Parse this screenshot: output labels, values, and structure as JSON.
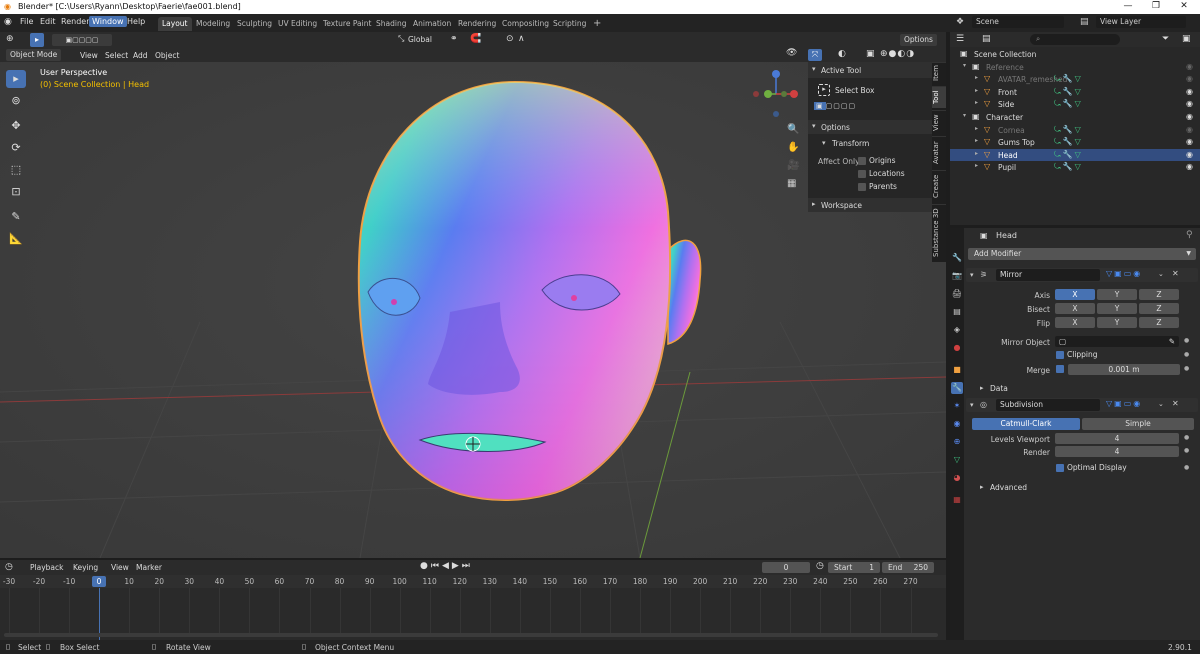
{
  "titlebar": {
    "title": "Blender* [C:\\Users\\Ryann\\Desktop\\Faerie\\fae001.blend]",
    "minimize": "—",
    "maximize": "❐",
    "close": "✕"
  },
  "menu": [
    "File",
    "Edit",
    "Render",
    "Window",
    "Help"
  ],
  "workspaces": [
    "Layout",
    "Modeling",
    "Sculpting",
    "UV Editing",
    "Texture Paint",
    "Shading",
    "Animation",
    "Rendering",
    "Compositing",
    "Scripting"
  ],
  "add_workspace": "+",
  "scene": {
    "label": "Scene",
    "view_layer": "View Layer"
  },
  "viewport_header": {
    "transform": "Global",
    "options": "Options"
  },
  "viewport_menu": {
    "mode": "Object Mode",
    "view": "View",
    "select": "Select",
    "add": "Add",
    "object": "Object"
  },
  "viewport_overlay": {
    "perspective": "User Perspective",
    "collection": "(0) Scene Collection | Head"
  },
  "npanel": {
    "active_tool_title": "Active Tool",
    "select_box": "Select Box",
    "options_title": "Options",
    "transform": "Transform",
    "affect_only": "Affect Only",
    "origins": "Origins",
    "locations": "Locations",
    "parents": "Parents",
    "workspace": "Workspace",
    "tabs": [
      "Item",
      "Tool",
      "View",
      "Avatar",
      "Create",
      "Substance 3D"
    ]
  },
  "outliner": {
    "search_placeholder": "",
    "rows": [
      {
        "label": "Scene Collection",
        "indent": 0,
        "dim": false,
        "sel": false
      },
      {
        "label": "Reference",
        "indent": 1,
        "dim": true,
        "sel": false
      },
      {
        "label": "AVATAR_remeshed",
        "indent": 2,
        "dim": true,
        "sel": false
      },
      {
        "label": "Front",
        "indent": 2,
        "dim": false,
        "sel": false
      },
      {
        "label": "Side",
        "indent": 2,
        "dim": false,
        "sel": false
      },
      {
        "label": "Character",
        "indent": 1,
        "dim": false,
        "sel": false
      },
      {
        "label": "Cornea",
        "indent": 2,
        "dim": true,
        "sel": false
      },
      {
        "label": "Gums Top",
        "indent": 2,
        "dim": false,
        "sel": false
      },
      {
        "label": "Head",
        "indent": 2,
        "dim": false,
        "sel": true
      },
      {
        "label": "Pupil",
        "indent": 2,
        "dim": false,
        "sel": false
      }
    ]
  },
  "properties": {
    "object_name": "Head",
    "add_modifier": "Add Modifier",
    "mirror": {
      "name": "Mirror",
      "axis_label": "Axis",
      "bisect_label": "Bisect",
      "flip_label": "Flip",
      "x": "X",
      "y": "Y",
      "z": "Z",
      "mirror_object_label": "Mirror Object",
      "clipping": "Clipping",
      "merge_label": "Merge",
      "merge_value": "0.001 m",
      "data": "Data"
    },
    "subdivision": {
      "name": "Subdivision",
      "catmull": "Catmull-Clark",
      "simple": "Simple",
      "levels_label": "Levels Viewport",
      "levels_value": "4",
      "render_label": "Render",
      "render_value": "4",
      "optimal": "Optimal Display",
      "advanced": "Advanced"
    }
  },
  "timeline": {
    "playback": "Playback",
    "keying": "Keying",
    "view": "View",
    "marker": "Marker",
    "current_frame": "0",
    "start_label": "Start",
    "start": "1",
    "end_label": "End",
    "end": "250",
    "ticks": [
      "-30",
      "-20",
      "-10",
      "0",
      "10",
      "20",
      "30",
      "40",
      "50",
      "60",
      "70",
      "80",
      "90",
      "100",
      "110",
      "120",
      "130",
      "140",
      "150",
      "160",
      "170",
      "180",
      "190",
      "200",
      "210",
      "220",
      "230",
      "240",
      "250",
      "260",
      "270"
    ],
    "current_tick": "0"
  },
  "statusbar": {
    "select": "Select",
    "box_select": "Box Select",
    "rotate": "Rotate View",
    "context": "Object Context Menu",
    "version": "2.90.1"
  },
  "colors": {
    "accent": "#4772b3",
    "selection": "#334d80",
    "outline": "#f0a040"
  }
}
